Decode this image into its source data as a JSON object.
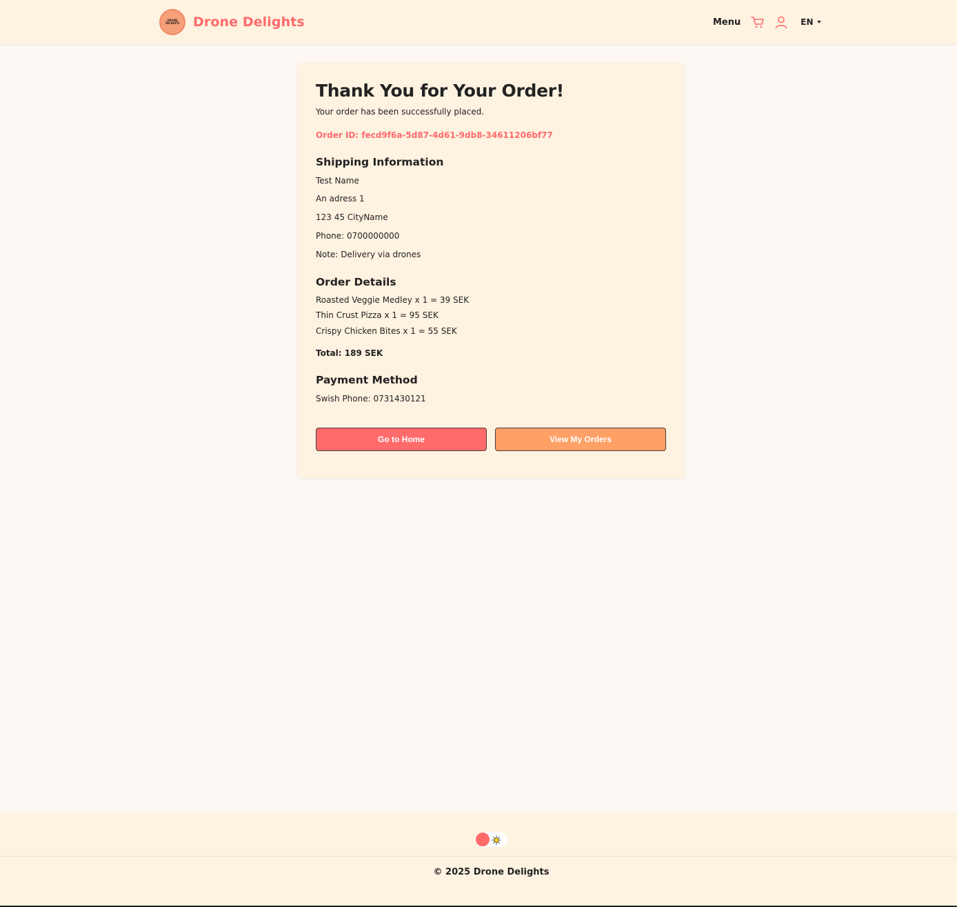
{
  "header": {
    "logo_text": "DRONE DELIGHTS",
    "brand": "Drone Delights",
    "nav": {
      "menu_label": "Menu",
      "cart_icon": "cart-icon",
      "user_icon": "user-icon",
      "language": "EN"
    }
  },
  "colors": {
    "accent": "#ff6b6b",
    "secondary": "#ffa066",
    "background": "#fef8f4",
    "panel": "#fef2e1"
  },
  "confirmation": {
    "title": "Thank You for Your Order!",
    "subtitle": "Your order has been successfully placed.",
    "order_id": "Order ID: fecd9f6a-5d87-4d61-9db8-34611206bf77",
    "shipping": {
      "heading": "Shipping Information",
      "name": "Test Name",
      "address": "An adress 1",
      "city": "123 45 CityName",
      "phone": "Phone: 0700000000",
      "note": "Note: Delivery via drones"
    },
    "order_details": {
      "heading": "Order Details",
      "items": [
        "Roasted Veggie Medley x 1 = 39 SEK",
        "Thin Crust Pizza x 1 = 95 SEK",
        "Crispy Chicken Bites x 1 = 55 SEK"
      ],
      "total": "Total: 189 SEK"
    },
    "payment": {
      "heading": "Payment Method",
      "method": "Swish Phone: 0731430121"
    },
    "buttons": {
      "home": "Go to Home",
      "orders": "View My Orders"
    }
  },
  "footer": {
    "theme_toggle_icon": "sun-icon",
    "copyright": "© 2025 Drone Delights"
  }
}
